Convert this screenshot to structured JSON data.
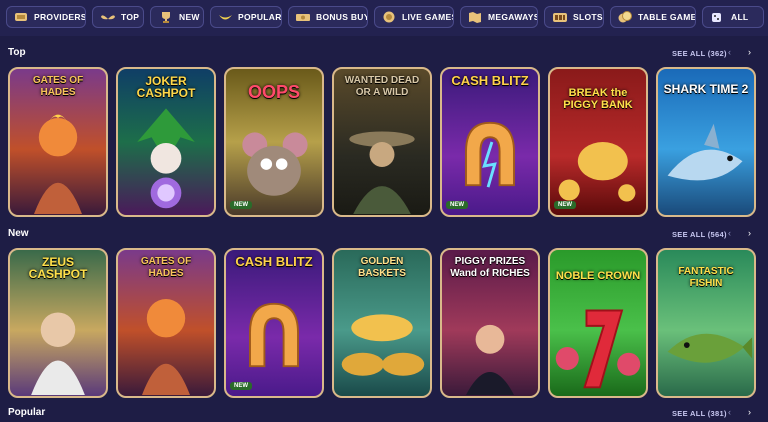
{
  "nav": {
    "items": [
      {
        "label": "PROVIDERS",
        "icon": "scroll-icon"
      },
      {
        "label": "TOP",
        "icon": "wings-icon"
      },
      {
        "label": "NEW",
        "icon": "trophy-icon"
      },
      {
        "label": "POPULAR",
        "icon": "banana-icon"
      },
      {
        "label": "BONUS BUYS",
        "icon": "ticket-icon"
      },
      {
        "label": "LIVE GAMES",
        "icon": "coin-icon"
      },
      {
        "label": "MEGAWAYS",
        "icon": "map-icon"
      },
      {
        "label": "SLOTS",
        "icon": "slot-icon"
      },
      {
        "label": "TABLE GAMES",
        "icon": "chips-icon"
      },
      {
        "label": "ALL",
        "icon": "dice-icon"
      }
    ]
  },
  "sections": [
    {
      "title": "Top",
      "see_all": "SEE ALL (362)",
      "games": [
        {
          "title": "GATES OF HADES",
          "new": false
        },
        {
          "title": "JOKER CASHPOT",
          "new": false
        },
        {
          "title": "OOPS",
          "new": true
        },
        {
          "title": "WANTED DEAD OR A WILD",
          "new": false
        },
        {
          "title": "CASH BLITZ",
          "new": true
        },
        {
          "title": "BREAK the PIGGY BANK",
          "new": true
        },
        {
          "title": "SHARK TIME 2",
          "new": false
        }
      ]
    },
    {
      "title": "New",
      "see_all": "SEE ALL (564)",
      "games": [
        {
          "title": "ZEUS CASHPOT",
          "new": false
        },
        {
          "title": "GATES OF HADES",
          "new": false
        },
        {
          "title": "CASH BLITZ",
          "new": true
        },
        {
          "title": "GOLDEN BASKETS",
          "new": false
        },
        {
          "title": "PIGGY PRIZES Wand of RICHES",
          "new": false
        },
        {
          "title": "NOBLE CROWN",
          "new": false
        },
        {
          "title": "FANTASTIC FISHIN",
          "new": false
        }
      ]
    },
    {
      "title": "Popular",
      "see_all": "SEE ALL (381)"
    }
  ],
  "new_badge": "NEW",
  "colors": {
    "background": "#1e1d45",
    "card_border": "#d9b98a",
    "accent_gold": "#f2c14e"
  }
}
